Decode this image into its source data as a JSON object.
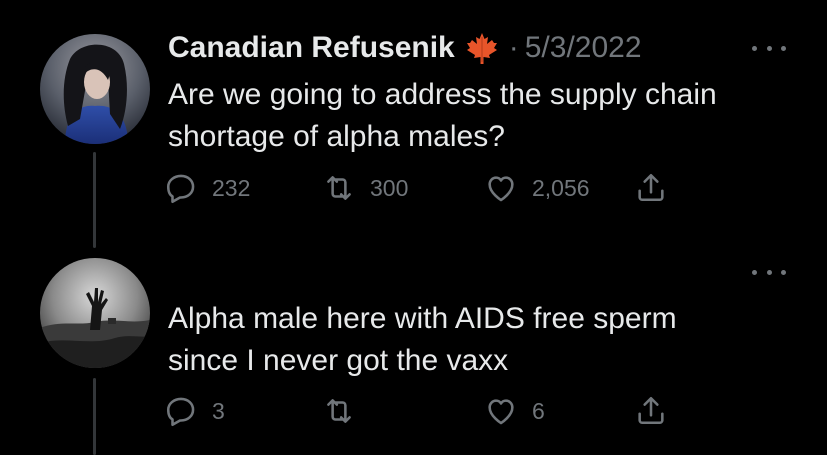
{
  "tweet": {
    "author_name": "Canadian Refusenik",
    "separator": "·",
    "date": "5/3/2022",
    "text_line1": "Are we going to address the supply chain",
    "text_line2": "shortage of alpha males?",
    "replies": "232",
    "retweets": "300",
    "likes": "2,056",
    "badge_icon": "maple-leaf-icon"
  },
  "reply": {
    "text_line1": "Alpha male here with AIDS free sperm",
    "text_line2": "since I never got the vaxx",
    "replies": "3",
    "retweets": "",
    "likes": "6"
  },
  "colors": {
    "background": "#000000",
    "text": "#e7e9ea",
    "muted": "#71767b",
    "thread_line": "#333639",
    "maple_leaf": "#e8552a"
  },
  "icons": [
    "reply-icon",
    "retweet-icon",
    "like-icon",
    "share-icon",
    "more-options-icon"
  ]
}
